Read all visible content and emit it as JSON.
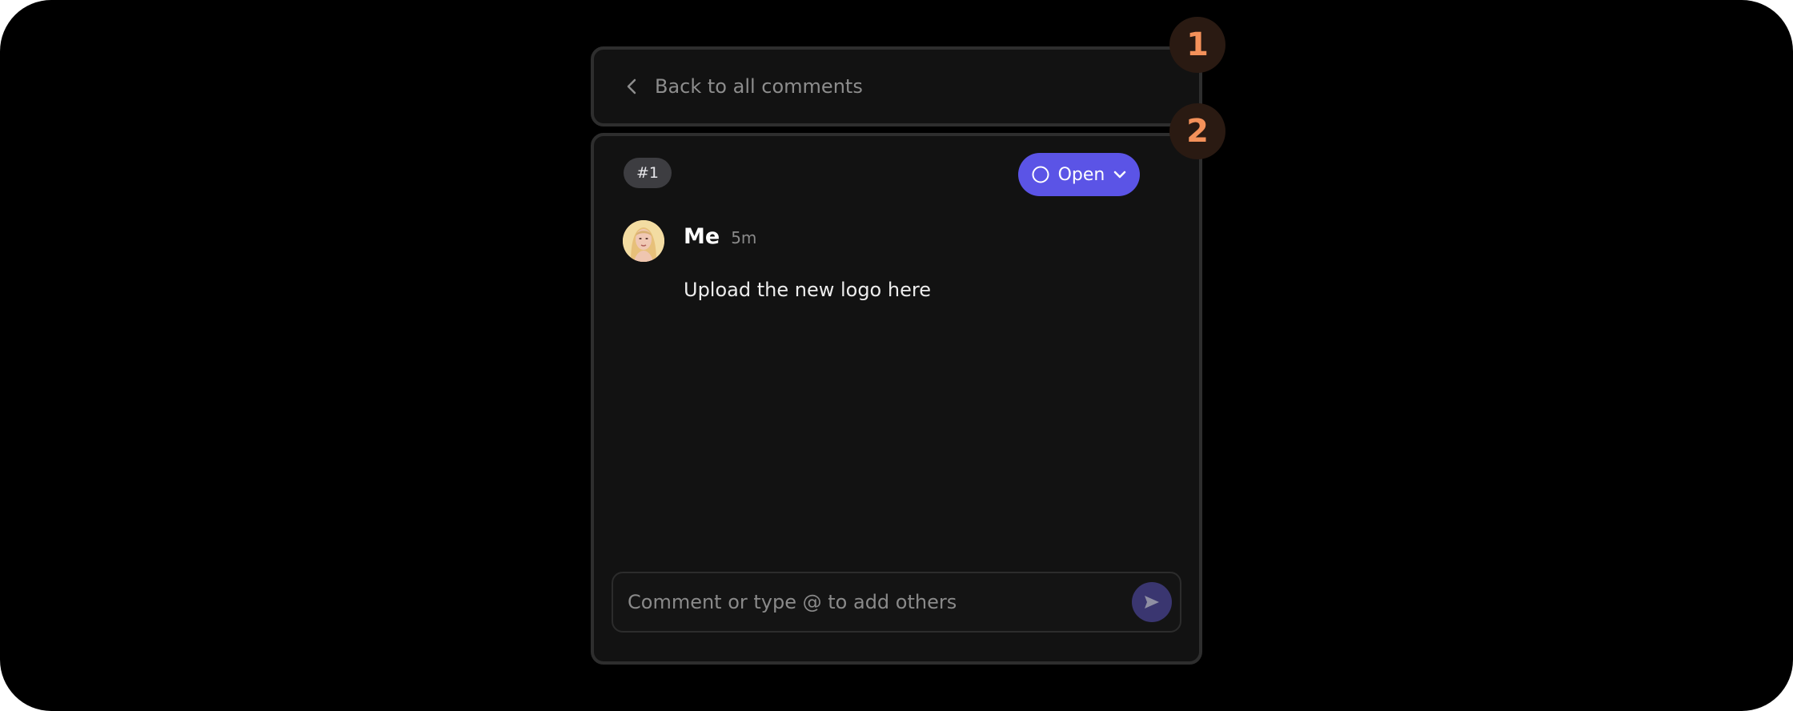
{
  "header": {
    "back_label": "Back to all comments",
    "back_icon": "chevron-left-icon"
  },
  "thread": {
    "id_badge": "#1",
    "status": {
      "label": "Open",
      "icon": "circle-outline-icon",
      "dropdown_icon": "chevron-down-icon",
      "color": "#5b54e6"
    },
    "comment": {
      "author": "Me",
      "time": "5m",
      "text": "Upload the new logo here"
    },
    "composer": {
      "placeholder": "Comment or type @ to add others",
      "value": "",
      "send_icon": "send-icon"
    }
  },
  "markers": {
    "first": "1",
    "second": "2",
    "color": "#f4915a"
  }
}
